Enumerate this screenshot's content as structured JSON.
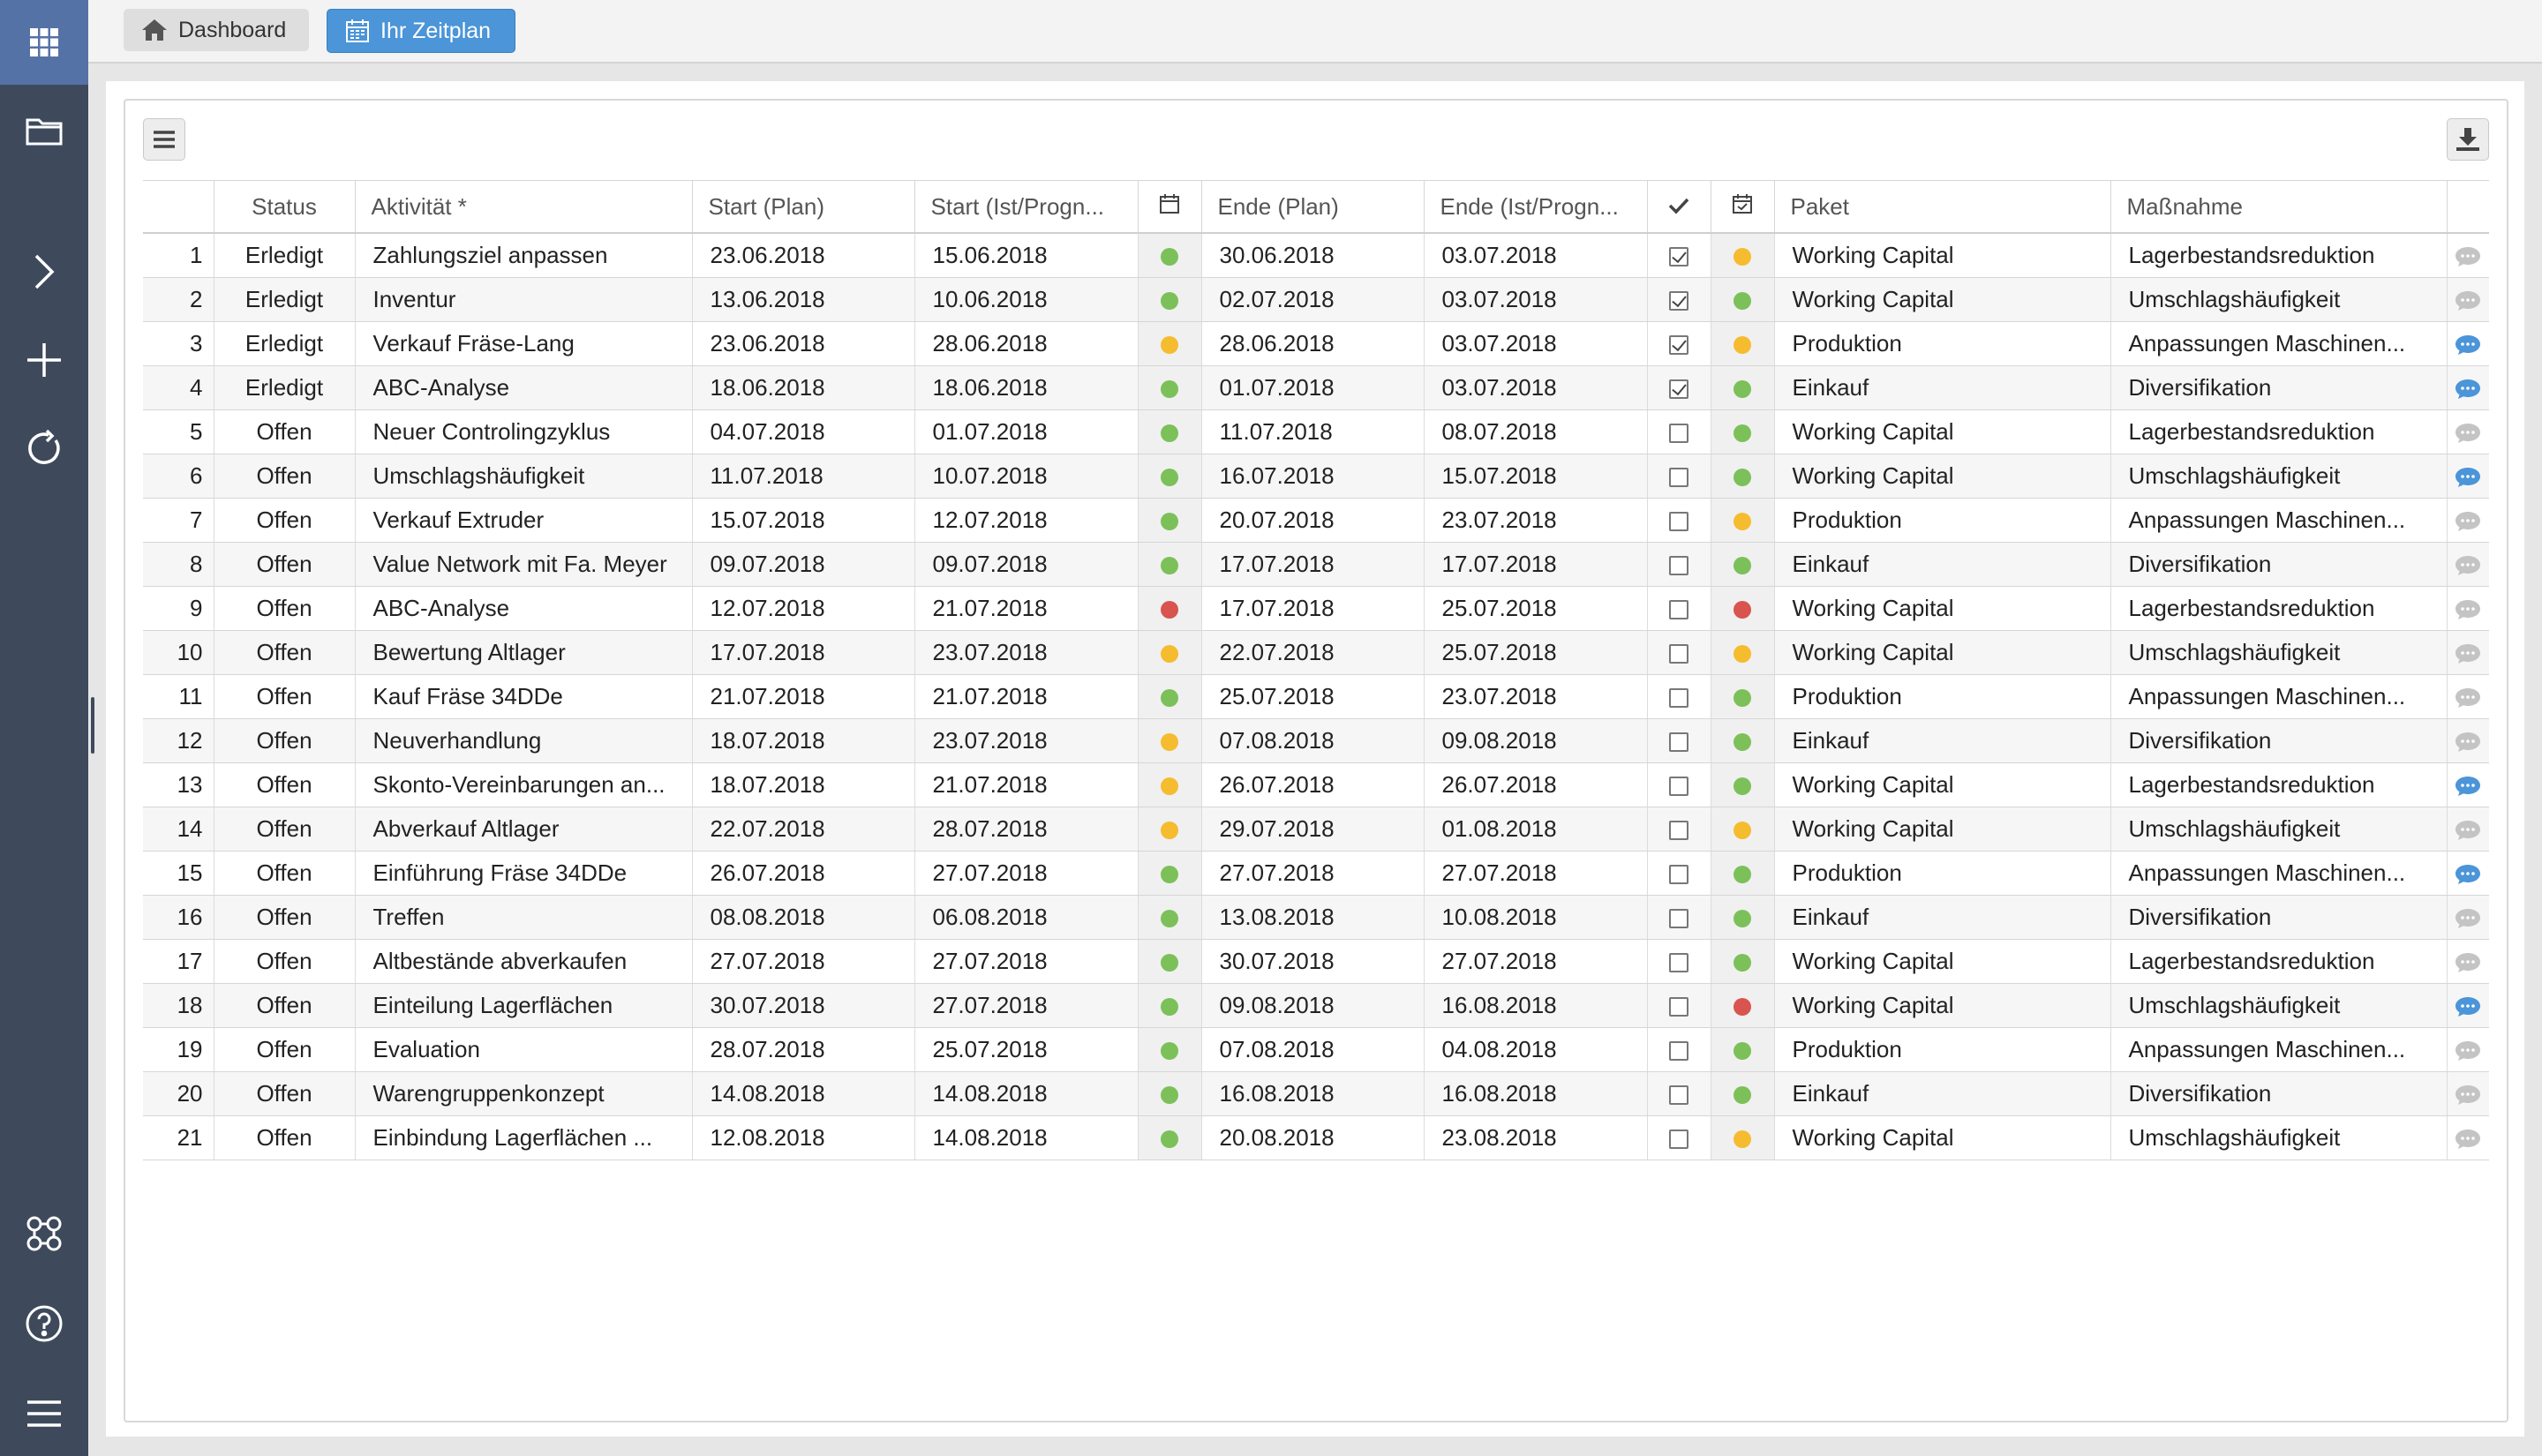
{
  "breadcrumb": {
    "home_label": "Dashboard",
    "current_label": "Ihr Zeitplan"
  },
  "sidebar": {
    "items": [
      {
        "icon": "apps-grid-icon"
      },
      {
        "icon": "folder-icon"
      },
      {
        "icon": "chevron-right-icon"
      },
      {
        "icon": "plus-icon"
      },
      {
        "icon": "refresh-icon"
      },
      {
        "icon": "network-icon"
      },
      {
        "icon": "help-icon"
      },
      {
        "icon": "hamburger-menu-icon"
      }
    ]
  },
  "colors": {
    "sidebar": "#3e4a5c",
    "accent": "#4b95d8",
    "done": "#6ab04c",
    "open": "#e14c3c",
    "dot_green": "#7cc05a",
    "dot_yellow": "#f5bc2f",
    "dot_red": "#d9534f",
    "link": "#3b8fd6"
  },
  "table": {
    "headers": {
      "status": "Status",
      "activity": "Aktivität *",
      "start_plan": "Start (Plan)",
      "start_actual": "Start (Ist/Progn...",
      "end_plan": "Ende (Plan)",
      "end_actual": "Ende (Ist/Progn...",
      "package": "Paket",
      "measure": "Maßnahme"
    },
    "rows": [
      {
        "nr": "1",
        "status": "Erledigt",
        "activity": "Zahlungsziel anpassen",
        "start_plan": "23.06.2018",
        "start_actual": "15.06.2018",
        "start_dot": "green",
        "end_plan": "30.06.2018",
        "end_actual": "03.07.2018",
        "done": true,
        "end_dot": "yellow",
        "package": "Working Capital",
        "measure": "Lagerbestandsreduktion",
        "comment": false
      },
      {
        "nr": "2",
        "status": "Erledigt",
        "activity": "Inventur",
        "start_plan": "13.06.2018",
        "start_actual": "10.06.2018",
        "start_dot": "green",
        "end_plan": "02.07.2018",
        "end_actual": "03.07.2018",
        "done": true,
        "end_dot": "green",
        "package": "Working Capital",
        "measure": "Umschlagshäufigkeit",
        "comment": false
      },
      {
        "nr": "3",
        "status": "Erledigt",
        "activity": "Verkauf Fräse-Lang",
        "start_plan": "23.06.2018",
        "start_actual": "28.06.2018",
        "start_dot": "yellow",
        "end_plan": "28.06.2018",
        "end_actual": "03.07.2018",
        "done": true,
        "end_dot": "yellow",
        "package": "Produktion",
        "measure": "Anpassungen Maschinen...",
        "comment": true
      },
      {
        "nr": "4",
        "status": "Erledigt",
        "activity": "ABC-Analyse",
        "start_plan": "18.06.2018",
        "start_actual": "18.06.2018",
        "start_dot": "green",
        "end_plan": "01.07.2018",
        "end_actual": "03.07.2018",
        "done": true,
        "end_dot": "green",
        "package": "Einkauf",
        "measure": "Diversifikation",
        "comment": true
      },
      {
        "nr": "5",
        "status": "Offen",
        "activity": "Neuer Controlingzyklus",
        "start_plan": "04.07.2018",
        "start_actual": "01.07.2018",
        "start_dot": "green",
        "end_plan": "11.07.2018",
        "end_actual": "08.07.2018",
        "done": false,
        "end_dot": "green",
        "package": "Working Capital",
        "measure": "Lagerbestandsreduktion",
        "comment": false
      },
      {
        "nr": "6",
        "status": "Offen",
        "activity": "Umschlagshäufigkeit",
        "start_plan": "11.07.2018",
        "start_actual": "10.07.2018",
        "start_dot": "green",
        "end_plan": "16.07.2018",
        "end_actual": "15.07.2018",
        "done": false,
        "end_dot": "green",
        "package": "Working Capital",
        "measure": "Umschlagshäufigkeit",
        "comment": true
      },
      {
        "nr": "7",
        "status": "Offen",
        "activity": "Verkauf Extruder",
        "start_plan": "15.07.2018",
        "start_actual": "12.07.2018",
        "start_dot": "green",
        "end_plan": "20.07.2018",
        "end_actual": "23.07.2018",
        "done": false,
        "end_dot": "yellow",
        "package": "Produktion",
        "measure": "Anpassungen Maschinen...",
        "comment": false
      },
      {
        "nr": "8",
        "status": "Offen",
        "activity": "Value Network mit Fa. Meyer",
        "start_plan": "09.07.2018",
        "start_actual": "09.07.2018",
        "start_dot": "green",
        "end_plan": "17.07.2018",
        "end_actual": "17.07.2018",
        "done": false,
        "end_dot": "green",
        "package": "Einkauf",
        "measure": "Diversifikation",
        "comment": false
      },
      {
        "nr": "9",
        "status": "Offen",
        "activity": "ABC-Analyse",
        "start_plan": "12.07.2018",
        "start_actual": "21.07.2018",
        "start_dot": "red",
        "end_plan": "17.07.2018",
        "end_actual": "25.07.2018",
        "done": false,
        "end_dot": "red",
        "package": "Working Capital",
        "measure": "Lagerbestandsreduktion",
        "comment": false
      },
      {
        "nr": "10",
        "status": "Offen",
        "activity": "Bewertung Altlager",
        "start_plan": "17.07.2018",
        "start_actual": "23.07.2018",
        "start_dot": "yellow",
        "end_plan": "22.07.2018",
        "end_actual": "25.07.2018",
        "done": false,
        "end_dot": "yellow",
        "package": "Working Capital",
        "measure": "Umschlagshäufigkeit",
        "comment": false
      },
      {
        "nr": "11",
        "status": "Offen",
        "activity": "Kauf Fräse 34DDe",
        "start_plan": "21.07.2018",
        "start_actual": "21.07.2018",
        "start_dot": "green",
        "end_plan": "25.07.2018",
        "end_actual": "23.07.2018",
        "done": false,
        "end_dot": "green",
        "package": "Produktion",
        "measure": "Anpassungen Maschinen...",
        "comment": false
      },
      {
        "nr": "12",
        "status": "Offen",
        "activity": "Neuverhandlung",
        "start_plan": "18.07.2018",
        "start_actual": "23.07.2018",
        "start_dot": "yellow",
        "end_plan": "07.08.2018",
        "end_actual": "09.08.2018",
        "done": false,
        "end_dot": "green",
        "package": "Einkauf",
        "measure": "Diversifikation",
        "comment": false
      },
      {
        "nr": "13",
        "status": "Offen",
        "activity": "Skonto-Vereinbarungen an...",
        "start_plan": "18.07.2018",
        "start_actual": "21.07.2018",
        "start_dot": "yellow",
        "end_plan": "26.07.2018",
        "end_actual": "26.07.2018",
        "done": false,
        "end_dot": "green",
        "package": "Working Capital",
        "measure": "Lagerbestandsreduktion",
        "comment": true
      },
      {
        "nr": "14",
        "status": "Offen",
        "activity": "Abverkauf Altlager",
        "start_plan": "22.07.2018",
        "start_actual": "28.07.2018",
        "start_dot": "yellow",
        "end_plan": "29.07.2018",
        "end_actual": "01.08.2018",
        "done": false,
        "end_dot": "yellow",
        "package": "Working Capital",
        "measure": "Umschlagshäufigkeit",
        "comment": false
      },
      {
        "nr": "15",
        "status": "Offen",
        "activity": "Einführung Fräse 34DDe",
        "start_plan": "26.07.2018",
        "start_actual": "27.07.2018",
        "start_dot": "green",
        "end_plan": "27.07.2018",
        "end_actual": "27.07.2018",
        "done": false,
        "end_dot": "green",
        "package": "Produktion",
        "measure": "Anpassungen Maschinen...",
        "comment": true
      },
      {
        "nr": "16",
        "status": "Offen",
        "activity": "Treffen",
        "start_plan": "08.08.2018",
        "start_actual": "06.08.2018",
        "start_dot": "green",
        "end_plan": "13.08.2018",
        "end_actual": "10.08.2018",
        "done": false,
        "end_dot": "green",
        "package": "Einkauf",
        "measure": "Diversifikation",
        "comment": false
      },
      {
        "nr": "17",
        "status": "Offen",
        "activity": "Altbestände abverkaufen",
        "start_plan": "27.07.2018",
        "start_actual": "27.07.2018",
        "start_dot": "green",
        "end_plan": "30.07.2018",
        "end_actual": "27.07.2018",
        "done": false,
        "end_dot": "green",
        "package": "Working Capital",
        "measure": "Lagerbestandsreduktion",
        "comment": false
      },
      {
        "nr": "18",
        "status": "Offen",
        "activity": "Einteilung Lagerflächen",
        "start_plan": "30.07.2018",
        "start_actual": "27.07.2018",
        "start_dot": "green",
        "end_plan": "09.08.2018",
        "end_actual": "16.08.2018",
        "done": false,
        "end_dot": "red",
        "package": "Working Capital",
        "measure": "Umschlagshäufigkeit",
        "comment": true
      },
      {
        "nr": "19",
        "status": "Offen",
        "activity": "Evaluation",
        "start_plan": "28.07.2018",
        "start_actual": "25.07.2018",
        "start_dot": "green",
        "end_plan": "07.08.2018",
        "end_actual": "04.08.2018",
        "done": false,
        "end_dot": "green",
        "package": "Produktion",
        "measure": "Anpassungen Maschinen...",
        "comment": false
      },
      {
        "nr": "20",
        "status": "Offen",
        "activity": "Warengruppenkonzept",
        "start_plan": "14.08.2018",
        "start_actual": "14.08.2018",
        "start_dot": "green",
        "end_plan": "16.08.2018",
        "end_actual": "16.08.2018",
        "done": false,
        "end_dot": "green",
        "package": "Einkauf",
        "measure": "Diversifikation",
        "comment": false
      },
      {
        "nr": "21",
        "status": "Offen",
        "activity": "Einbindung Lagerflächen ...",
        "start_plan": "12.08.2018",
        "start_actual": "14.08.2018",
        "start_dot": "green",
        "end_plan": "20.08.2018",
        "end_actual": "23.08.2018",
        "done": false,
        "end_dot": "yellow",
        "package": "Working Capital",
        "measure": "Umschlagshäufigkeit",
        "comment": false
      }
    ]
  }
}
